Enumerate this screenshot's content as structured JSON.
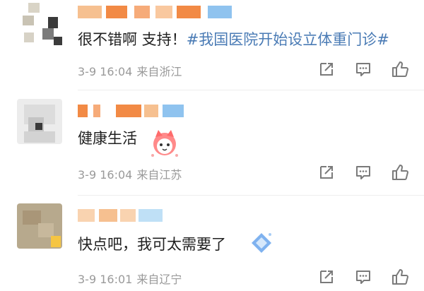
{
  "comments": [
    {
      "text_plain": "很不错啊 支持！",
      "topic": "#我国医院开始设立体重门诊#",
      "time": "3-9 16:04",
      "location": "来自浙江"
    },
    {
      "text_plain": "健康生活",
      "time": "3-9 16:04",
      "location": "来自江苏"
    },
    {
      "text_plain": "快点吧，我可太需要了",
      "time": "3-9 16:01",
      "location": "来自辽宁"
    }
  ],
  "colors": {
    "topic": "#4a7bb5",
    "meta_text": "#9a9a9a",
    "username_orange": "#f28a45",
    "username_blue": "#8fc3ef"
  },
  "icons": [
    "share-icon",
    "comment-icon",
    "like-icon"
  ]
}
